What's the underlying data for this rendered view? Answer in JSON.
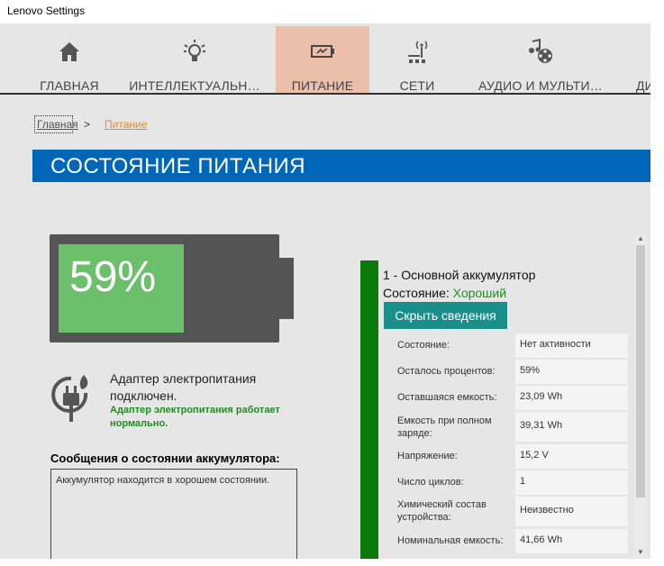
{
  "window": {
    "title": "Lenovo Settings"
  },
  "nav": {
    "items": [
      {
        "label": "ГЛАВНАЯ",
        "icon": "home-icon"
      },
      {
        "label": "ИНТЕЛЛЕКТУАЛЬН…",
        "icon": "lightbulb-icon"
      },
      {
        "label": "ПИТАНИЕ",
        "icon": "battery-charging-icon",
        "active": true
      },
      {
        "label": "СЕТИ",
        "icon": "network-icon"
      },
      {
        "label": "АУДИО И МУЛЬТИ…",
        "icon": "media-icon"
      },
      {
        "label": "ДИ",
        "icon": ""
      }
    ]
  },
  "breadcrumb": {
    "home": "Главная",
    "separator": ">",
    "current": "Питание"
  },
  "section": {
    "title": "СОСТОЯНИЕ ПИТАНИЯ"
  },
  "battery": {
    "percent_text": "59%",
    "level": 0.59,
    "fill_color": "#6cc06c"
  },
  "adapter": {
    "title": "Адаптер электропитания подключен.",
    "status": "Адаптер электропитания работает нормально."
  },
  "messages": {
    "title": "Сообщения о состоянии аккумулятора:",
    "text": "Аккумулятор находится в хорошем состоянии."
  },
  "details": {
    "name": "1 - Основной аккумулятор",
    "state_label": "Состояние:",
    "state_value": "Хороший",
    "toggle_button": "Скрыть сведения",
    "rows": [
      {
        "key": "Состояние:",
        "value": "Нет активности"
      },
      {
        "key": "Осталось процентов:",
        "value": "59%"
      },
      {
        "key": "Оставшаяся емкость:",
        "value": "23,09 Wh"
      },
      {
        "key": "Емкость при полном заряде:",
        "value": "39,31 Wh"
      },
      {
        "key": "Напряжение:",
        "value": "15,2 V"
      },
      {
        "key": "Число циклов:",
        "value": "1"
      },
      {
        "key": "Химический состав устройства:",
        "value": "Неизвестно"
      },
      {
        "key": "Номинальная емкость:",
        "value": "41,66 Wh"
      }
    ]
  },
  "colors": {
    "accent_blue": "#0067b8",
    "active_tab": "#ebbfa9",
    "good_green": "#1e8f1e",
    "button_teal": "#1a8f8a"
  }
}
